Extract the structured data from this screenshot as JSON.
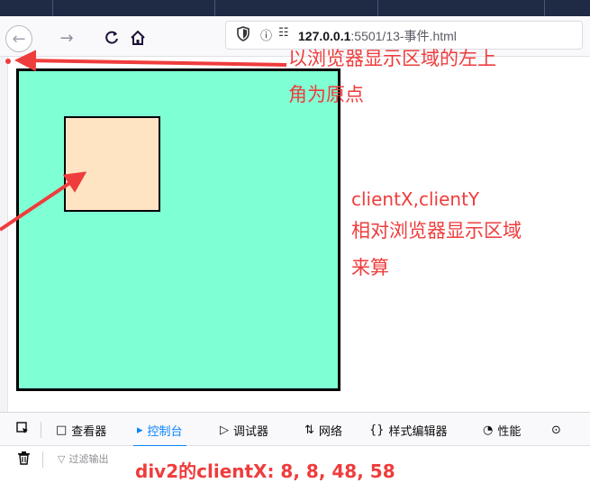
{
  "browser": {
    "nav": {
      "back_icon": "←",
      "forward_icon": "→",
      "reload_icon": "C",
      "home_icon": "⌂"
    },
    "url": {
      "info_icon": "ⓘ",
      "perm_icon": "☷",
      "host": "127.0.0.1",
      "path": ":5501/13-事件.html"
    }
  },
  "page": {
    "colors": {
      "outer_box": "#7fffd4",
      "inner_box": "#ffe4c4",
      "annotation": "#ef3c3c"
    },
    "annotations": {
      "origin_line1": "以浏览器显示区域的左上",
      "origin_line2": "角为原点",
      "client_line1": "clientX,clientY",
      "client_line2": "相对浏览器显示区域",
      "client_line3": "来算"
    }
  },
  "devtools": {
    "tabs": [
      {
        "label": "查看器",
        "icon": "inspector-icon"
      },
      {
        "label": "控制台",
        "icon": "console-icon",
        "active": true
      },
      {
        "label": "调试器",
        "icon": "debugger-icon"
      },
      {
        "label": "网络",
        "icon": "network-icon"
      },
      {
        "label": "样式编辑器",
        "icon": "style-editor-icon"
      },
      {
        "label": "性能",
        "icon": "performance-icon"
      }
    ],
    "console": {
      "filter_placeholder": "过滤输出",
      "output_text": "div2的clientX: 8, 8, 48, 58"
    }
  }
}
